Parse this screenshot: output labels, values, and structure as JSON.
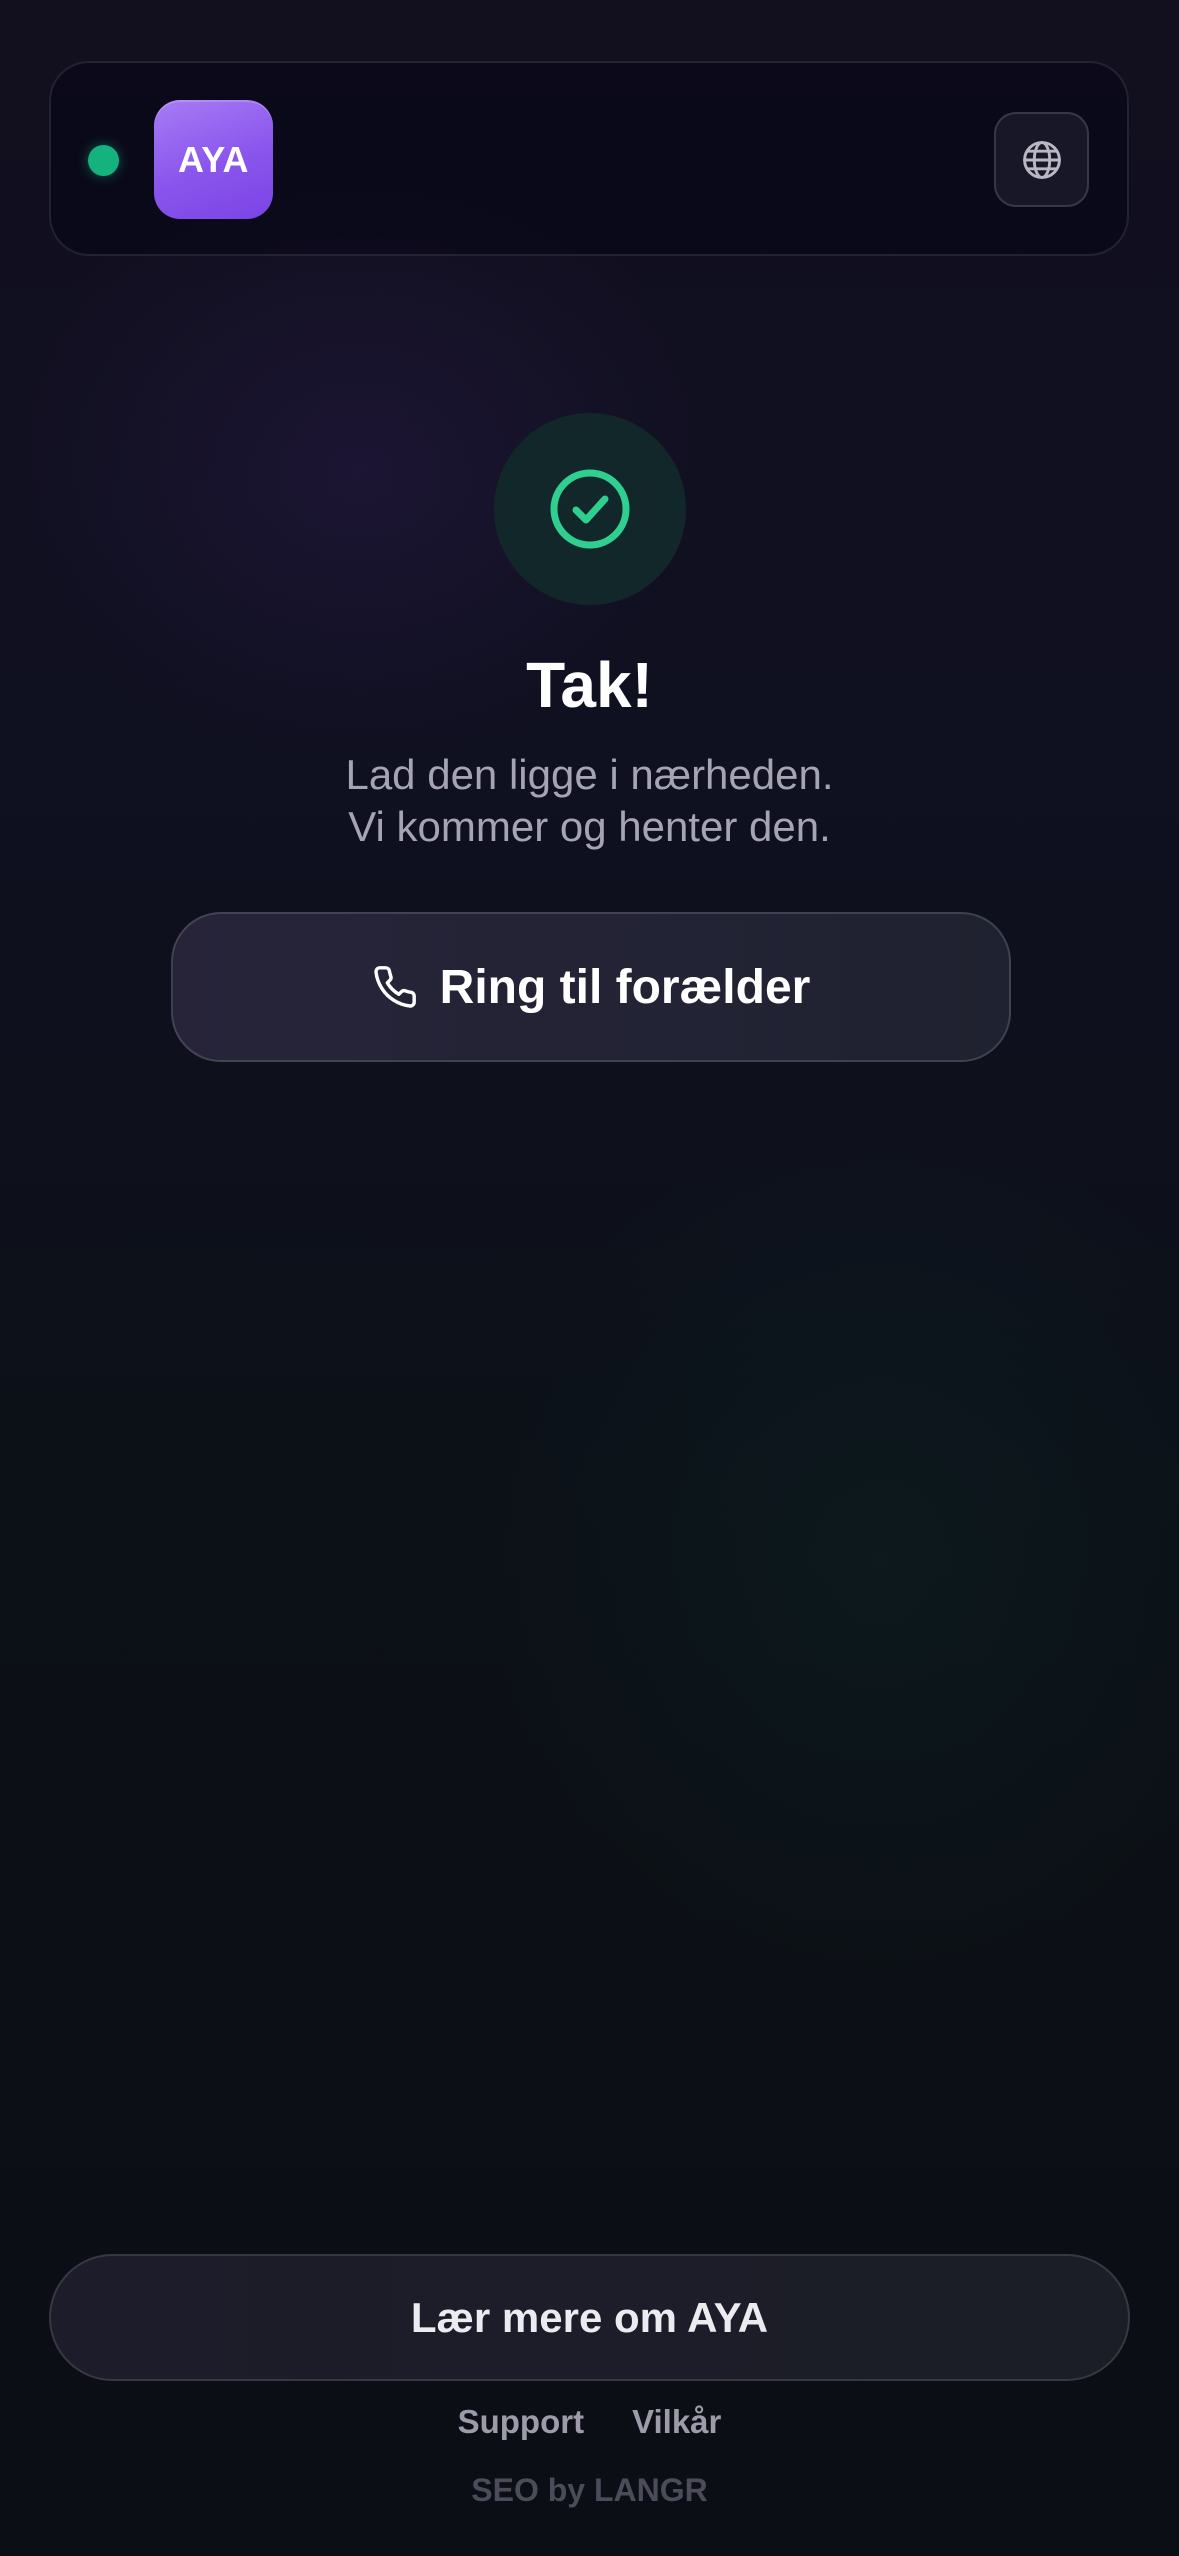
{
  "header": {
    "logo_text": "AYA",
    "status_color": "#14b37d",
    "logo_color": "#8a55ec",
    "language_icon": "globe-icon"
  },
  "main": {
    "success_icon": "check-circle-icon",
    "success_color": "#2fd08f",
    "title": "Tak!",
    "subtitle_line1": "Lad den ligge i nærheden.",
    "subtitle_line2": "Vi kommer og henter den.",
    "call_button": {
      "icon": "phone-icon",
      "label": "Ring til forælder"
    }
  },
  "footer": {
    "learn_more_label": "Lær mere om AYA",
    "links": [
      "Support",
      "Vilkår"
    ],
    "credit": "SEO by LANGR"
  }
}
